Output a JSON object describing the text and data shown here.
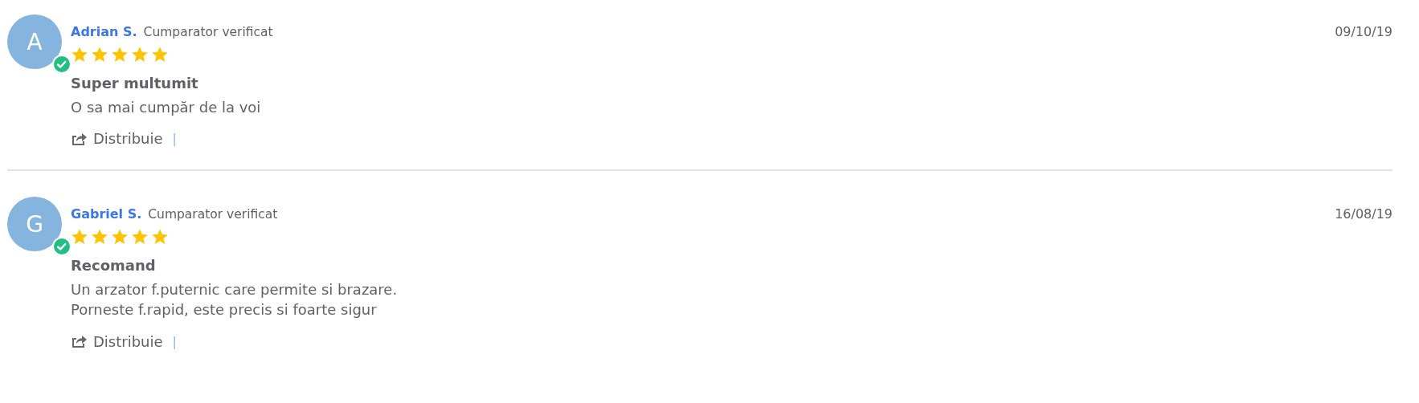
{
  "reviews": [
    {
      "initial": "A",
      "verified": true,
      "author": "Adrian S.",
      "badge": "Cumparator verificat",
      "stars": 5,
      "date": "09/10/19",
      "title": "Super multumit",
      "body": "O sa mai cumpăr de la voi",
      "share": "Distribuie",
      "separator": "|"
    },
    {
      "initial": "G",
      "verified": true,
      "author": "Gabriel S.",
      "badge": "Cumparator verificat",
      "stars": 5,
      "date": "16/08/19",
      "title": "Recomand",
      "body": "Un arzator f.puternic care permite si brazare.\nPorneste f.rapid, este precis si foarte sigur",
      "share": "Distribuie",
      "separator": "|"
    }
  ]
}
